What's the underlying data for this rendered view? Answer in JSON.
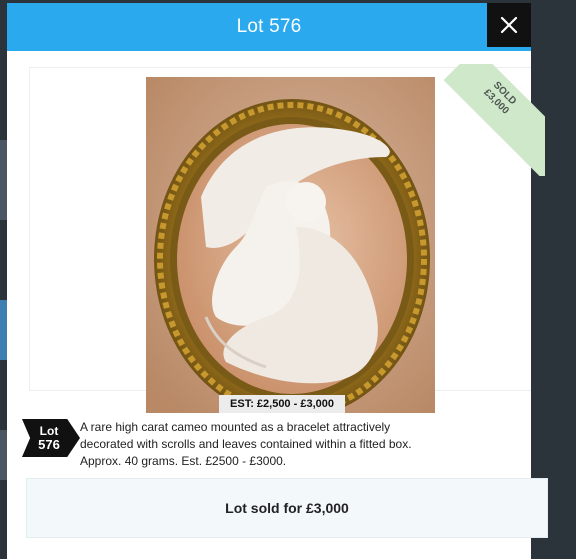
{
  "modal": {
    "title": "Lot 576",
    "close_icon": "close-icon"
  },
  "lot": {
    "tag_label": "Lot",
    "tag_number": "576",
    "estimate": "EST: £2,500 - £3,000",
    "description": "A rare high carat cameo mounted as a bracelet attractively decorated with scrolls and leaves contained within a fitted box. Approx. 40 grams. Est. £2500 - £3000.",
    "ribbon_line1": "SOLD",
    "ribbon_line2": "£3,000",
    "sold_message": "Lot sold for £3,000"
  },
  "colors": {
    "header": "#2aa9ef",
    "ribbon": "#cfe8c9",
    "sold_box": "#f3f8fb"
  }
}
